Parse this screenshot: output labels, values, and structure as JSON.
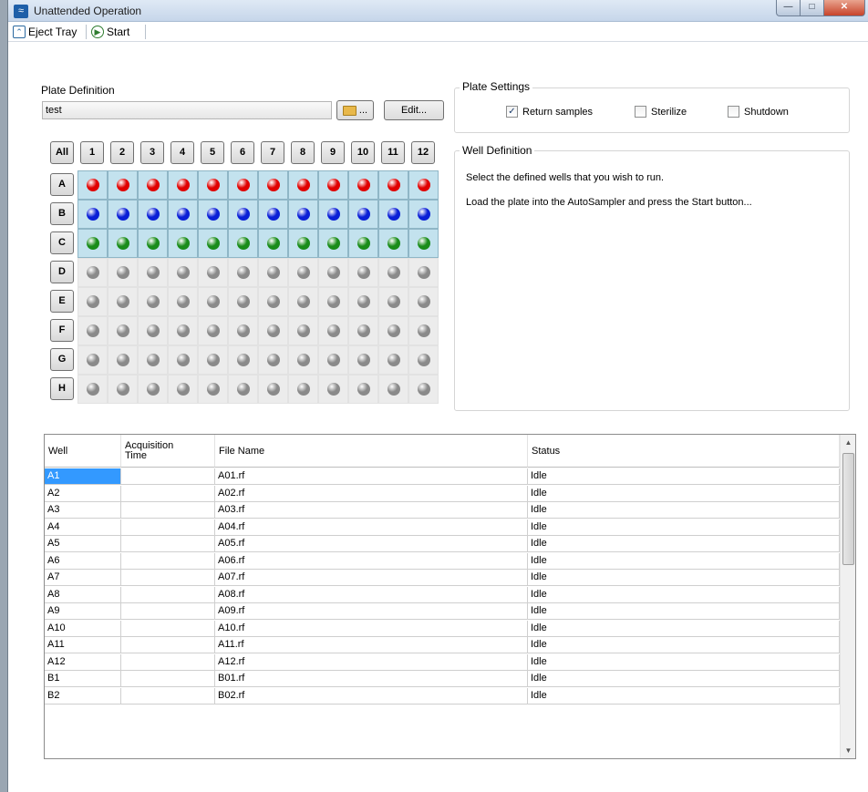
{
  "window": {
    "title": "Unattended Operation",
    "minimize": "—",
    "maximize": "□",
    "close": "✕"
  },
  "toolbar": {
    "eject_label": "Eject Tray",
    "start_label": "Start",
    "eject_icon": "eject-icon",
    "start_icon": "play-icon"
  },
  "plate_definition": {
    "label": "Plate Definition",
    "value": "test",
    "browse_label": "...",
    "edit_label": "Edit..."
  },
  "plate_settings": {
    "legend": "Plate Settings",
    "options": [
      {
        "label": "Return samples",
        "checked": true
      },
      {
        "label": "Sterilize",
        "checked": false
      },
      {
        "label": "Shutdown",
        "checked": false
      }
    ]
  },
  "well_definition": {
    "legend": "Well Definition",
    "line1": "Select the defined wells that you wish to run.",
    "line2": "Load the plate into the AutoSampler and press the Start button..."
  },
  "grid": {
    "all_label": "All",
    "columns": [
      "1",
      "2",
      "3",
      "4",
      "5",
      "6",
      "7",
      "8",
      "9",
      "10",
      "11",
      "12"
    ],
    "rows": [
      "A",
      "B",
      "C",
      "D",
      "E",
      "F",
      "G",
      "H"
    ],
    "row_colors": {
      "A": "#e00000",
      "B": "#0a1fd6",
      "C": "#1a8c1a",
      "D": "#8a8a8a",
      "E": "#8a8a8a",
      "F": "#8a8a8a",
      "G": "#8a8a8a",
      "H": "#8a8a8a"
    },
    "selected_rows": [
      "A",
      "B",
      "C"
    ]
  },
  "table": {
    "headers": [
      "Well",
      "Acquisition\nTime",
      "File Name",
      "Status"
    ],
    "rows": [
      {
        "well": "A1",
        "time": "",
        "file": "A01.rf",
        "status": "Idle"
      },
      {
        "well": "A2",
        "time": "",
        "file": "A02.rf",
        "status": "Idle"
      },
      {
        "well": "A3",
        "time": "",
        "file": "A03.rf",
        "status": "Idle"
      },
      {
        "well": "A4",
        "time": "",
        "file": "A04.rf",
        "status": "Idle"
      },
      {
        "well": "A5",
        "time": "",
        "file": "A05.rf",
        "status": "Idle"
      },
      {
        "well": "A6",
        "time": "",
        "file": "A06.rf",
        "status": "Idle"
      },
      {
        "well": "A7",
        "time": "",
        "file": "A07.rf",
        "status": "Idle"
      },
      {
        "well": "A8",
        "time": "",
        "file": "A08.rf",
        "status": "Idle"
      },
      {
        "well": "A9",
        "time": "",
        "file": "A09.rf",
        "status": "Idle"
      },
      {
        "well": "A10",
        "time": "",
        "file": "A10.rf",
        "status": "Idle"
      },
      {
        "well": "A11",
        "time": "",
        "file": "A11.rf",
        "status": "Idle"
      },
      {
        "well": "A12",
        "time": "",
        "file": "A12.rf",
        "status": "Idle"
      },
      {
        "well": "B1",
        "time": "",
        "file": "B01.rf",
        "status": "Idle"
      },
      {
        "well": "B2",
        "time": "",
        "file": "B02.rf",
        "status": "Idle"
      }
    ],
    "selected_row": 0
  }
}
